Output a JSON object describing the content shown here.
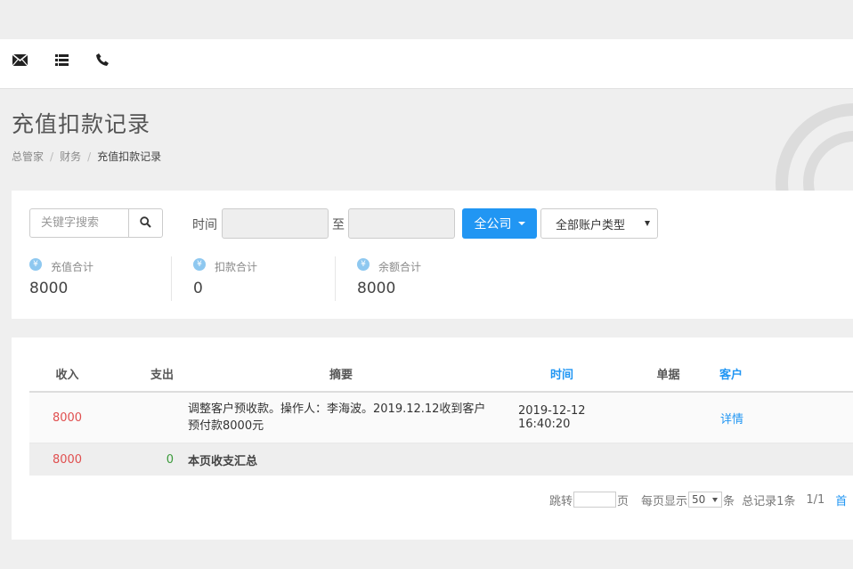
{
  "nav": {
    "icons": [
      "envelope-icon",
      "list-icon",
      "phone-icon"
    ]
  },
  "page_title": "充值扣款记录",
  "breadcrumb": {
    "items": [
      "总管家",
      "财务",
      "充值扣款记录"
    ]
  },
  "filters": {
    "search_placeholder": "关键字搜索",
    "time_label": "时间",
    "to_label": "至",
    "company_label": "全公司",
    "account_type_label": "全部账户类型"
  },
  "stats": [
    {
      "label": "充值合计",
      "value": "8000"
    },
    {
      "label": "扣款合计",
      "value": "0"
    },
    {
      "label": "余额合计",
      "value": "8000"
    }
  ],
  "table": {
    "headers": [
      "收入",
      "支出",
      "摘要",
      "时间",
      "单据",
      "客户"
    ],
    "rows": [
      {
        "income": "8000",
        "expense": "",
        "summary_line1": "调整客户预收款。操作人：李海波。2019.12.12收到客户",
        "summary_line2": "预付款8000元",
        "time": "2019-12-12 16:40:20",
        "voucher": "",
        "customer": "详情"
      }
    ],
    "summary_row": {
      "income": "8000",
      "expense": "0",
      "label": "本页收支汇总"
    }
  },
  "pagination": {
    "jump_label": "跳转",
    "page_unit": "页",
    "per_page_label": "每页显示",
    "per_page_value": "50",
    "per_page_unit": "条",
    "total_label": "总记录1条",
    "page_info": "1/1",
    "first_label": "首"
  },
  "colors": {
    "accent": "#2196f3",
    "income": "#e04f4f",
    "expense": "#3a9a3a"
  }
}
